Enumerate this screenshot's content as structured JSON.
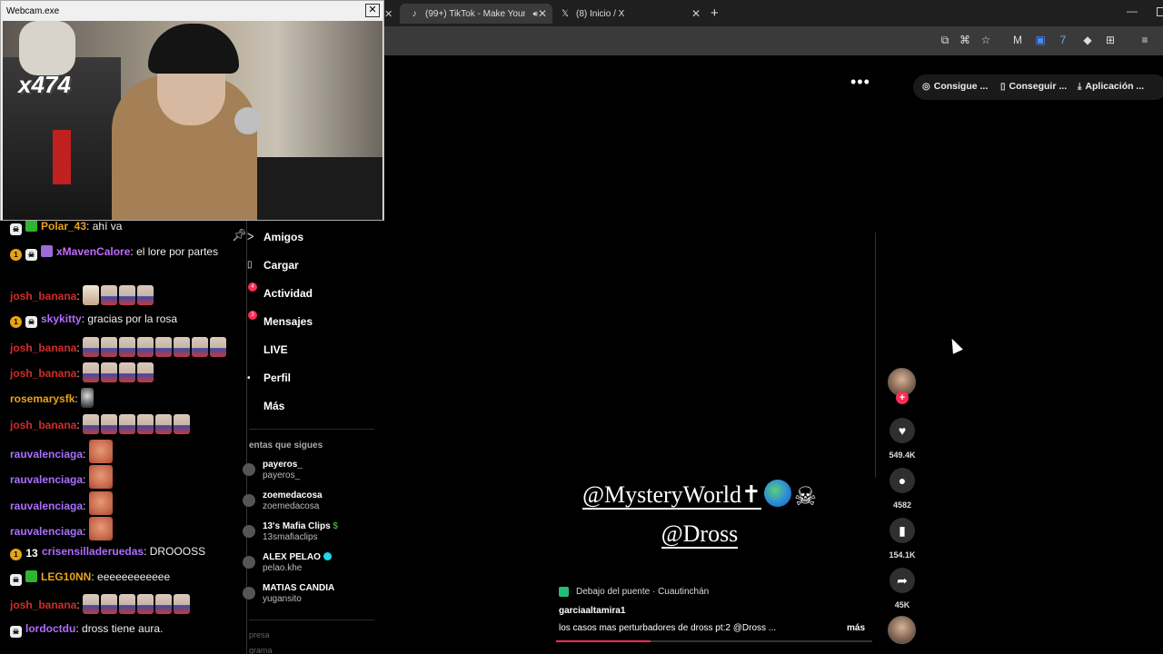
{
  "browser": {
    "tabs": [
      {
        "label": "(99+) TikTok - Make Your Da",
        "icon": "tiktok-icon",
        "active": true
      },
      {
        "label": "(8) Inicio / X",
        "icon": "x-icon",
        "active": false
      }
    ],
    "new_tab": "+",
    "minimize": "—"
  },
  "tiktok_header": {
    "more": "•••",
    "pills": [
      "Consigue ...",
      "Conseguir ...",
      "Aplicación ..."
    ]
  },
  "webcam": {
    "title": "Webcam.exe",
    "close": "✕",
    "overlay_tag": "x474"
  },
  "chat": {
    "messages": [
      {
        "user": "Polar_43",
        "color": "#e8a317",
        "text": "ahí va"
      },
      {
        "user": "xMavenCalore",
        "color": "#c46bff",
        "text": "el lore por partes",
        "badge_num": "1"
      },
      {
        "user": "josh_banana",
        "color": "#d12d2d",
        "text": ""
      },
      {
        "user": "skykitty",
        "color": "#b06bff",
        "text": "gracias por la rosa",
        "badge_num": "1"
      },
      {
        "user": "josh_banana",
        "color": "#d12d2d",
        "text": ""
      },
      {
        "user": "josh_banana",
        "color": "#d12d2d",
        "text": ""
      },
      {
        "user": "rosemarysfk",
        "color": "#e8a317",
        "text": ""
      },
      {
        "user": "josh_banana",
        "color": "#d12d2d",
        "text": ""
      },
      {
        "user": "rauvalenciaga",
        "color": "#a970ff",
        "text": ""
      },
      {
        "user": "rauvalenciaga",
        "color": "#a970ff",
        "text": ""
      },
      {
        "user": "rauvalenciaga",
        "color": "#a970ff",
        "text": ""
      },
      {
        "user": "rauvalenciaga",
        "color": "#a970ff",
        "text": ""
      },
      {
        "user": "crisensilladeruedas",
        "color": "#b06bff",
        "text": "DROOOSS",
        "badge_num": "1",
        "badge_13": "13"
      },
      {
        "user": "LEG10NN",
        "color": "#e8a317",
        "text": "eeeeeeeeeeee"
      },
      {
        "user": "josh_banana",
        "color": "#d12d2d",
        "text": ""
      },
      {
        "user": "lordoctdu",
        "color": "#b06bff",
        "text": "dross tiene aura."
      }
    ],
    "separator": ":"
  },
  "sidebar": {
    "nav": [
      "Amigos",
      "Cargar",
      "Actividad",
      "Mensajes",
      "LIVE",
      "Perfil",
      "Más"
    ],
    "section_title": "entas que sigues",
    "following": [
      {
        "name": "payeros_",
        "user": "payeros_"
      },
      {
        "name": "zoemedacosa",
        "user": "zoemedacosa"
      },
      {
        "name": "13's Mafia Clips",
        "user": "13smafiaclips",
        "extra": "$"
      },
      {
        "name": "ALEX PELAO",
        "user": "pelao.khe",
        "verified": true
      },
      {
        "name": "MATIAS CANDIA",
        "user": "yugansito"
      }
    ],
    "footer": [
      "presa",
      "grama"
    ]
  },
  "video": {
    "caption_line1": "@MysteryWorld✝",
    "caption_line2": "@Dross",
    "music": "Debajo del puente · Cuautinchán",
    "author": "garciaaltamira1",
    "description": "los casos mas perturbadores de dross pt:2 @Dross  ...",
    "more": "más",
    "progress": 0.3
  },
  "actions": {
    "likes": "549.4K",
    "comments": "4582",
    "saves": "154.1K",
    "shares": "45K"
  },
  "colors": {
    "tiktok_pink": "#fe2c55",
    "tab_bg": "#3a3a3a"
  }
}
